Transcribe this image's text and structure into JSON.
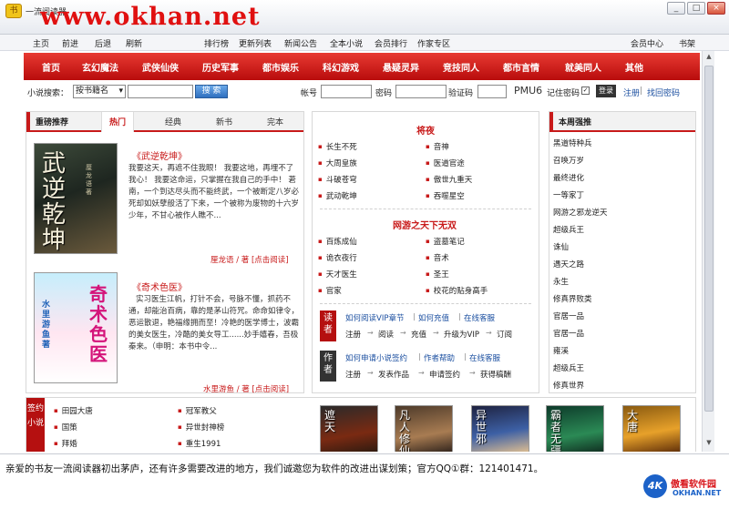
{
  "window": {
    "app_title": "一流阅读器",
    "watermark": "www.okhan.net",
    "buttons": [
      "_",
      "□",
      "×"
    ]
  },
  "menubar": {
    "left": [
      "主页",
      "前进",
      "后退",
      "刷新"
    ],
    "center": [
      "排行榜",
      "更新列表",
      "新闻公告",
      "全本小说",
      "会员排行",
      "作家专区"
    ],
    "right": [
      "会员中心",
      "书架"
    ]
  },
  "nav": [
    "首页",
    "玄幻魔法",
    "武侠仙侠",
    "历史军事",
    "都市娱乐",
    "科幻游戏",
    "悬疑灵异",
    "竞技同人",
    "都市言情",
    "就美同人",
    "其他"
  ],
  "search": {
    "label": "小说搜索：",
    "select_value": "按书籍名",
    "button": "搜  索",
    "account_label": "帐号",
    "password_label": "密码",
    "captcha_label": "验证码",
    "captcha_text": "PMU6",
    "remember_label": "记住密码",
    "login_button": "登录",
    "register_link": "注册",
    "forgot_link": "找回密码"
  },
  "left_panel": {
    "header": "重磅推荐",
    "tabs": [
      "热门",
      "经典",
      "新书",
      "完本"
    ],
    "books": [
      {
        "title": "《武逆乾坤》",
        "cover_title": "武逆乾坤",
        "cover_author": "厘龙语著",
        "desc": "我要这天，再遮不住我眼！ 我要这地，再埋不了我心！ 我要这命运，只掌握在我自己的手中！ 莙南，一个到达尽头而不能终武，一个被断定八岁必死却如妖孽般活了下来，一个被称为废物的十六岁少年，不甘心被作人瞧不...",
        "meta": "厘龙语 / 著   [点击阅读]"
      },
      {
        "title": "《奇术色医》",
        "cover_title": "奇术色医",
        "cover_author": "水里游鱼著",
        "desc": "实习医生江帆，打针不会，号脉不懂，抓药不通，却能治百病，靠的是茅山符咒。命命如律令，恶运散退，艳福缘拥而至！冷艳的医学博士，波霸的美女医生，冷酷的美女导工......妙手嬉春，吾极秦来。（申明：本书中令...",
        "meta": "水里游鱼 / 著   [点击阅读]"
      }
    ]
  },
  "middle_panel": {
    "section1_title": "将夜",
    "section1_items": [
      "长生不死",
      "音神",
      "大周皇族",
      "医道官途",
      "斗破苍穹",
      "傲世九重天",
      "武动乾坤",
      "吞噬星空"
    ],
    "section2_title": "网游之天下无双",
    "section2_items": [
      "百炼成仙",
      "盗墓笔记",
      "诡衣夜行",
      "音术",
      "天才医生",
      "圣王",
      "官家",
      "校花的贴身高手"
    ],
    "reader_badge": "读者",
    "reader_row1": [
      "如何阅读VIP章节",
      "如何充值",
      "在线客服"
    ],
    "reader_row2": [
      "注册",
      "阅读",
      "充值",
      "升级为VIP",
      "订阅"
    ],
    "author_badge": "作者",
    "author_row1": [
      "如何申请小说签约",
      "作者帮助",
      "在线客服"
    ],
    "author_row2": [
      "注册",
      "发表作品",
      "申请签约",
      "获得稿酬"
    ]
  },
  "right_panel": {
    "header": "本周强推",
    "items": [
      "黑道特种兵",
      "召唤万岁",
      "最终进化",
      "一等家丁",
      "网游之邪龙逆天",
      "超级兵王",
      "诛仙",
      "遇天之路",
      "永生",
      "修真界败类",
      "官居一品",
      "官居一品",
      "雍溪",
      "超级兵王",
      "修真世界"
    ]
  },
  "bottom_panel": {
    "tag": "签约小说",
    "items_left": [
      "田园大唐",
      "国策",
      "拜婚"
    ],
    "items_right": [
      "冠军教父",
      "异世封神榜",
      "重生1991"
    ],
    "thumbs": [
      "遮天",
      "凡人修仙",
      "异世邪",
      "霸者无疆",
      "大唐"
    ]
  },
  "status": {
    "text": "亲爱的书友一流阅读器初出茅庐，还有许多需要改进的地方，我们诚邀您为软件的改进出谋划策；官方QQ①群：121401471。",
    "logo_mark": "4K",
    "logo_cn": "傲看软件园",
    "logo_en": "OKHAN.NET"
  },
  "colors": {
    "brand_red": "#c81a1a",
    "link_blue": "#1b4fa0",
    "watermark_red": "#e01010"
  }
}
